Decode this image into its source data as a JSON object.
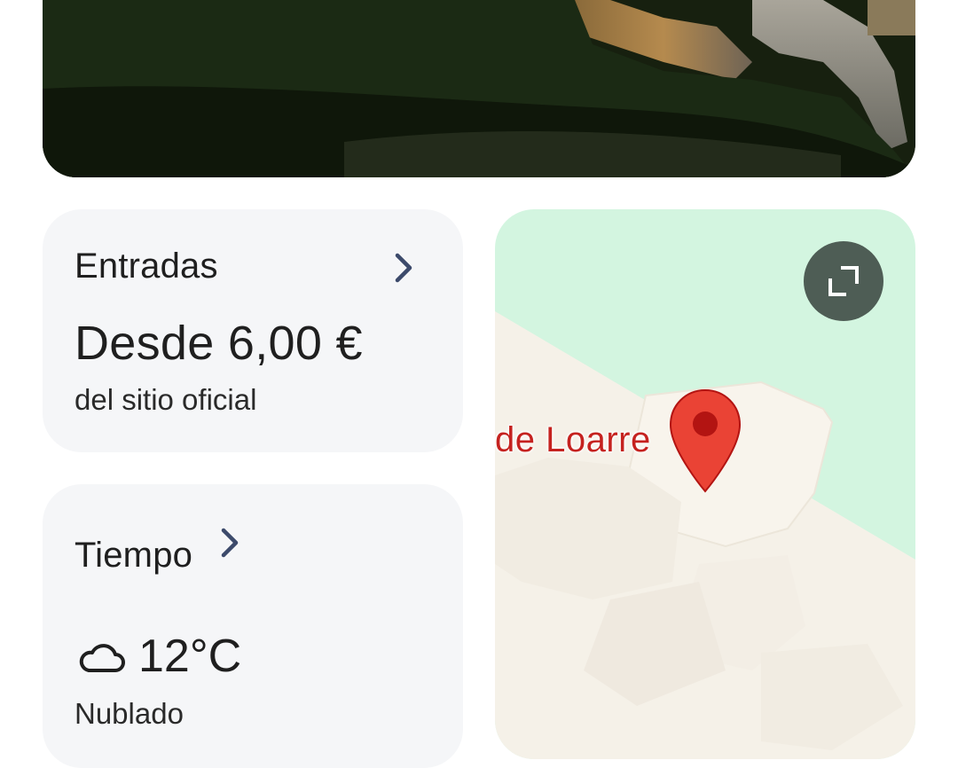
{
  "tickets": {
    "title": "Entradas",
    "price": "Desde 6,00 €",
    "source": "del sitio oficial"
  },
  "weather": {
    "title": "Tiempo",
    "temperature": "12°C",
    "condition": "Nublado",
    "icon": "cloud-icon"
  },
  "map": {
    "place_label": "de Loarre",
    "pin_color": "#ea4335",
    "water_color": "#d3f5e0",
    "land_color": "#f5f1e8"
  },
  "colors": {
    "card_background": "#f5f6f8",
    "chevron": "#3c4a6b",
    "expand_button": "#4e5d55"
  }
}
